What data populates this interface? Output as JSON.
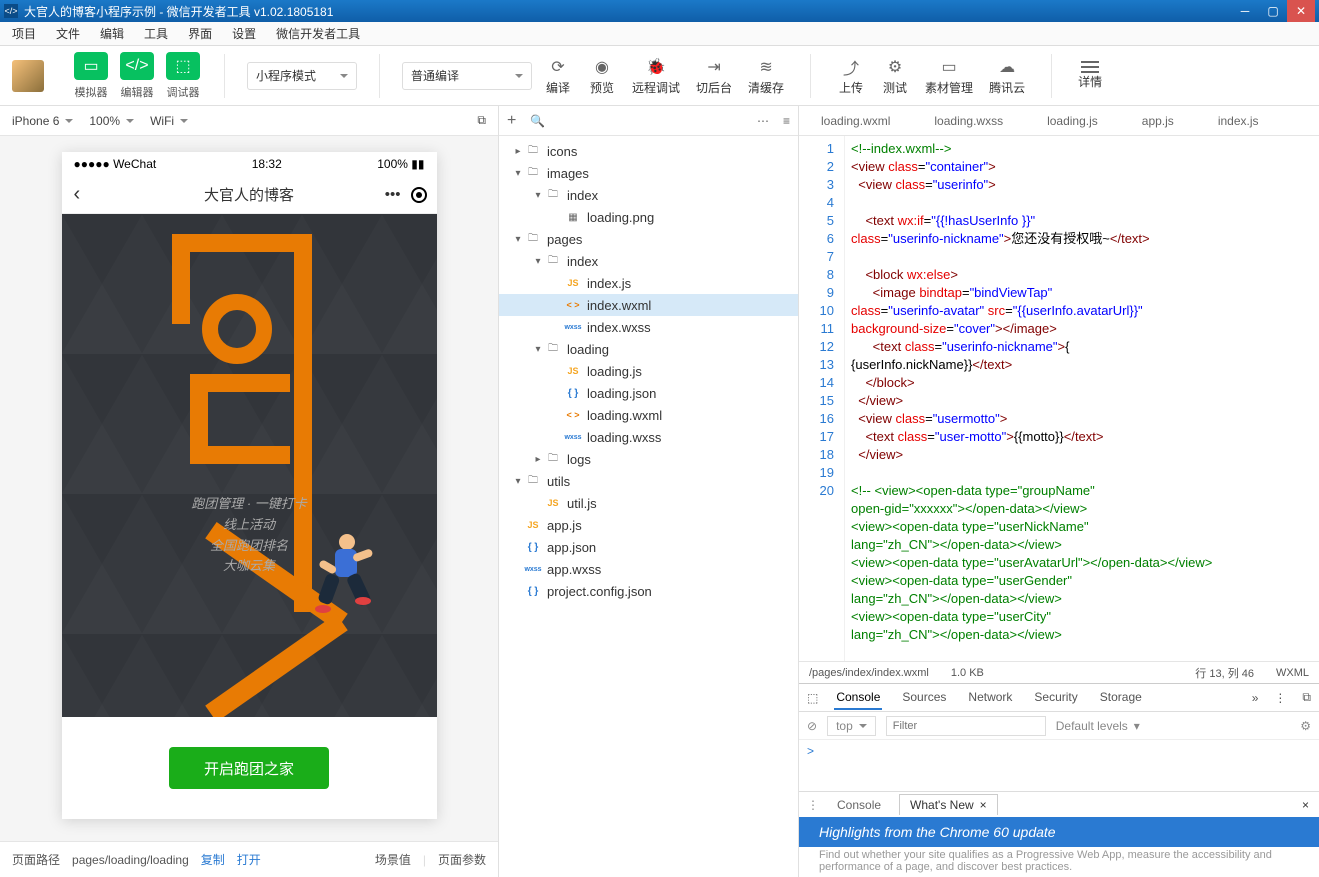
{
  "window": {
    "title": "大官人的博客小程序示例 - 微信开发者工具 v1.02.1805181"
  },
  "menu": [
    "项目",
    "文件",
    "编辑",
    "工具",
    "界面",
    "设置",
    "微信开发者工具"
  ],
  "toolbar": {
    "simulator": "模拟器",
    "editor": "编辑器",
    "debugger": "调试器",
    "mode": "小程序模式",
    "compile": "普通编译",
    "actions": {
      "compile_btn": "编译",
      "preview": "预览",
      "remote": "远程调试",
      "background": "切后台",
      "clear": "清缓存",
      "upload": "上传",
      "test": "测试",
      "assets": "素材管理",
      "cloud": "腾讯云",
      "details": "详情"
    }
  },
  "sim": {
    "device": "iPhone 6",
    "zoom": "100%",
    "network": "WiFi"
  },
  "phone": {
    "carrier": "●●●●● WeChat",
    "signal": "⚲",
    "time": "18:32",
    "battery": "100%",
    "title": "大官人的博客",
    "lines": [
      "跑团管理 · 一键打卡",
      "线上活动",
      "全国跑团排名",
      "大咖云集"
    ],
    "button": "开启跑团之家"
  },
  "pathbar": {
    "label": "页面路径",
    "path": "pages/loading/loading",
    "copy": "复制",
    "open": "打开",
    "scene": "场景值",
    "pageargs": "页面参数"
  },
  "tree": [
    {
      "d": 0,
      "t": "folder",
      "chev": "▸",
      "name": "icons"
    },
    {
      "d": 0,
      "t": "folder",
      "chev": "▾",
      "name": "images"
    },
    {
      "d": 1,
      "t": "folder",
      "chev": "▾",
      "name": "index"
    },
    {
      "d": 2,
      "t": "img",
      "name": "loading.png"
    },
    {
      "d": 0,
      "t": "folder",
      "chev": "▾",
      "name": "pages"
    },
    {
      "d": 1,
      "t": "folder",
      "chev": "▾",
      "name": "index"
    },
    {
      "d": 2,
      "t": "js",
      "name": "index.js"
    },
    {
      "d": 2,
      "t": "wxml",
      "name": "index.wxml",
      "sel": true
    },
    {
      "d": 2,
      "t": "wxss",
      "name": "index.wxss"
    },
    {
      "d": 1,
      "t": "folder",
      "chev": "▾",
      "name": "loading"
    },
    {
      "d": 2,
      "t": "js",
      "name": "loading.js"
    },
    {
      "d": 2,
      "t": "json",
      "name": "loading.json"
    },
    {
      "d": 2,
      "t": "wxml",
      "name": "loading.wxml"
    },
    {
      "d": 2,
      "t": "wxss",
      "name": "loading.wxss"
    },
    {
      "d": 1,
      "t": "folder",
      "chev": "▸",
      "name": "logs"
    },
    {
      "d": 0,
      "t": "folder",
      "chev": "▾",
      "name": "utils"
    },
    {
      "d": 1,
      "t": "js",
      "name": "util.js"
    },
    {
      "d": 0,
      "t": "js",
      "name": "app.js"
    },
    {
      "d": 0,
      "t": "json",
      "name": "app.json"
    },
    {
      "d": 0,
      "t": "wxss",
      "name": "app.wxss"
    },
    {
      "d": 0,
      "t": "json",
      "name": "project.config.json"
    }
  ],
  "editor_tabs": [
    "loading.wxml",
    "loading.wxss",
    "loading.js",
    "app.js",
    "index.js"
  ],
  "code_lines": [
    1,
    2,
    3,
    4,
    5,
    6,
    7,
    8,
    9,
    10,
    11,
    12,
    13,
    14,
    15,
    16,
    17,
    18,
    19,
    20
  ],
  "code_html": "<span class='c-cm'>&lt;!--index.wxml--&gt;</span>\n<span class='c-br'>&lt;</span><span class='c-tag'>view</span> <span class='c-attr'>class</span>=<span class='c-str'>\"container\"</span><span class='c-br'>&gt;</span>\n  <span class='c-br'>&lt;</span><span class='c-tag'>view</span> <span class='c-attr'>class</span>=<span class='c-str'>\"userinfo\"</span><span class='c-br'>&gt;</span>\n\n    <span class='c-br'>&lt;</span><span class='c-tag'>text</span> <span class='c-attr'>wx:if</span>=<span class='c-str'>\"{{!hasUserInfo }}\"</span>\n<span class='c-attr'>class</span>=<span class='c-str'>\"userinfo-nickname\"</span><span class='c-br'>&gt;</span>您还没有授权哦~<span class='c-br'>&lt;/</span><span class='c-tag'>text</span><span class='c-br'>&gt;</span>\n\n    <span class='c-br'>&lt;</span><span class='c-tag'>block</span> <span class='c-attr'>wx:else</span><span class='c-br'>&gt;</span>\n      <span class='c-br'>&lt;</span><span class='c-tag'>image</span> <span class='c-attr'>bindtap</span>=<span class='c-str'>\"bindViewTap\"</span>\n<span class='c-attr'>class</span>=<span class='c-str'>\"userinfo-avatar\"</span> <span class='c-attr'>src</span>=<span class='c-str'>\"{{userInfo.avatarUrl}}\"</span>\n<span class='c-attr'>background-size</span>=<span class='c-str'>\"cover\"</span><span class='c-br'>&gt;&lt;/</span><span class='c-tag'>image</span><span class='c-br'>&gt;</span>\n      <span class='c-br'>&lt;</span><span class='c-tag'>text</span> <span class='c-attr'>class</span>=<span class='c-str'>\"userinfo-nickname\"</span><span class='c-br'>&gt;</span>{\n{userInfo.nickName}}<span class='c-br'>&lt;/</span><span class='c-tag'>text</span><span class='c-br'>&gt;</span>\n    <span class='c-br'>&lt;/</span><span class='c-tag'>block</span><span class='c-br'>&gt;</span>\n  <span class='c-br'>&lt;/</span><span class='c-tag'>view</span><span class='c-br'>&gt;</span>\n  <span class='c-br'>&lt;</span><span class='c-tag'>view</span> <span class='c-attr'>class</span>=<span class='c-str'>\"usermotto\"</span><span class='c-br'>&gt;</span>\n    <span class='c-br'>&lt;</span><span class='c-tag'>text</span> <span class='c-attr'>class</span>=<span class='c-str'>\"user-motto\"</span><span class='c-br'>&gt;</span>{{motto}}<span class='c-br'>&lt;/</span><span class='c-tag'>text</span><span class='c-br'>&gt;</span>\n  <span class='c-br'>&lt;/</span><span class='c-tag'>view</span><span class='c-br'>&gt;</span>\n\n<span class='c-cm'>&lt;!-- &lt;view&gt;&lt;open-data type=\"groupName\"\nopen-gid=\"xxxxxx\"&gt;&lt;/open-data&gt;&lt;/view&gt;\n&lt;view&gt;&lt;open-data type=\"userNickName\"\nlang=\"zh_CN\"&gt;&lt;/open-data&gt;&lt;/view&gt;\n&lt;view&gt;&lt;open-data type=\"userAvatarUrl\"&gt;&lt;/open-data&gt;&lt;/view&gt;\n&lt;view&gt;&lt;open-data type=\"userGender\"\nlang=\"zh_CN\"&gt;&lt;/open-data&gt;&lt;/view&gt;\n&lt;view&gt;&lt;open-data type=\"userCity\"\nlang=\"zh_CN\"&gt;&lt;/open-data&gt;&lt;/view&gt;</span>",
  "status": {
    "file": "/pages/index/index.wxml",
    "size": "1.0 KB",
    "pos": "行 13, 列 46",
    "lang": "WXML"
  },
  "devtools": {
    "tabs": [
      "Console",
      "Sources",
      "Network",
      "Security",
      "Storage"
    ],
    "context": "top",
    "filter_ph": "Filter",
    "levels": "Default levels",
    "prompt": ">",
    "whatsnew_console": "Console",
    "whatsnew": "What's New",
    "headline": "Highlights from the Chrome 60 update",
    "desc": "Find out whether your site qualifies as a Progressive Web App, measure the accessibility and performance of a page, and discover best practices."
  }
}
